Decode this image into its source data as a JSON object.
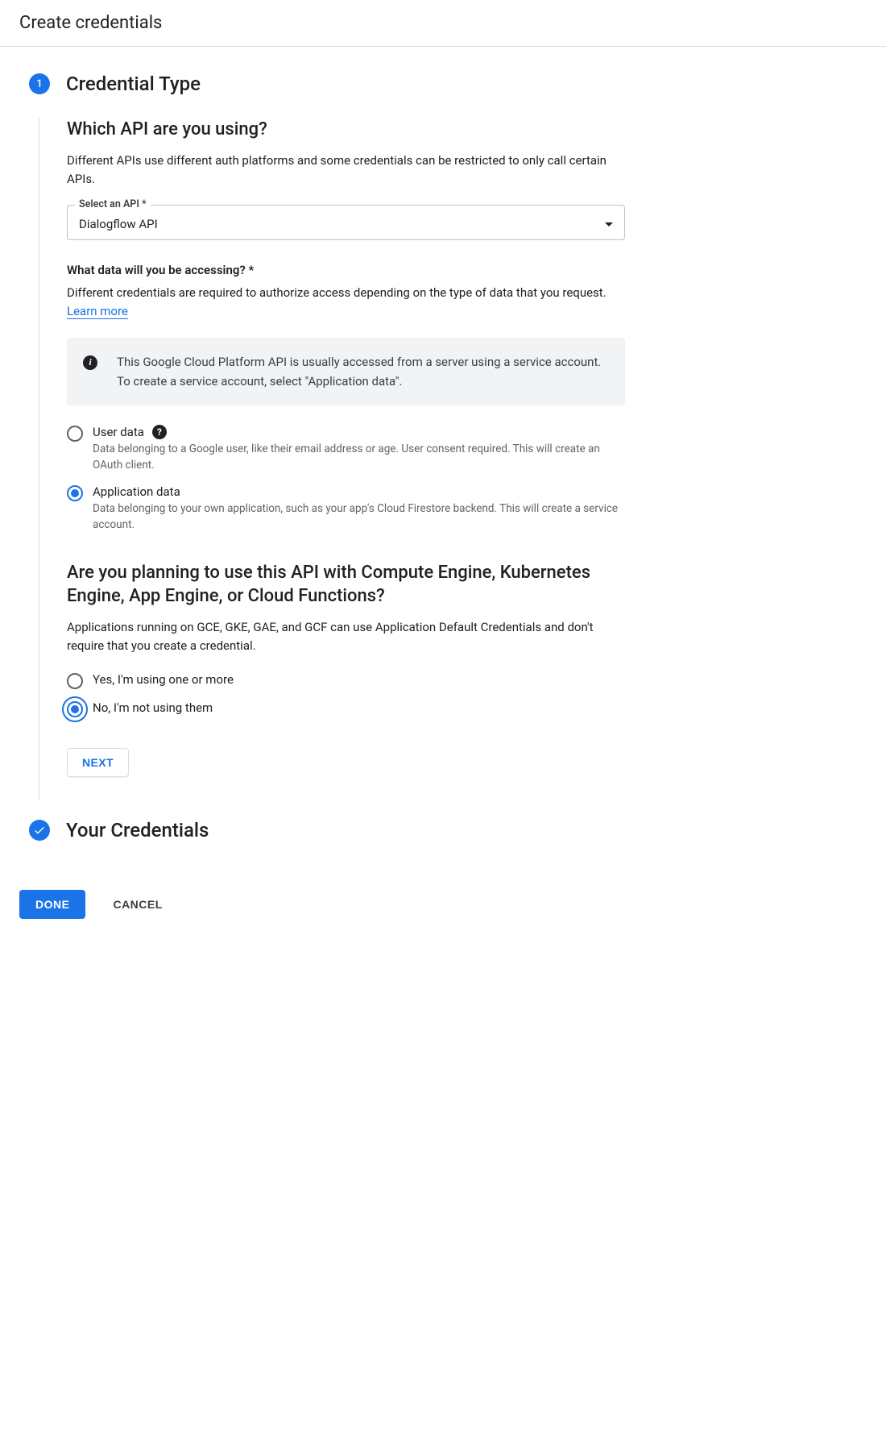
{
  "header": {
    "title": "Create credentials"
  },
  "step1": {
    "number": "1",
    "title": "Credential Type",
    "section1": {
      "heading": "Which API are you using?",
      "desc": "Different APIs use different auth platforms and some credentials can be restricted to only call certain APIs.",
      "select_label": "Select an API *",
      "select_value": "Dialogflow API"
    },
    "section2": {
      "label": "What data will you be accessing? *",
      "desc_prefix": "Different credentials are required to authorize access depending on the type of data that you request. ",
      "learn_more": "Learn more",
      "info": "This Google Cloud Platform API is usually accessed from a server using a service account. To create a service account, select \"Application data\".",
      "radios": [
        {
          "label": "User data",
          "desc": "Data belonging to a Google user, like their email address or age. User consent required. This will create an OAuth client.",
          "checked": false,
          "help": true
        },
        {
          "label": "Application data",
          "desc": "Data belonging to your own application, such as your app's Cloud Firestore backend. This will create a service account.",
          "checked": true,
          "help": false
        }
      ]
    },
    "section3": {
      "heading": "Are you planning to use this API with Compute Engine, Kubernetes Engine, App Engine, or Cloud Functions?",
      "desc": "Applications running on GCE, GKE, GAE, and GCF can use Application Default Credentials and don't require that you create a credential.",
      "radios": [
        {
          "label": "Yes, I'm using one or more",
          "checked": false,
          "focus": false
        },
        {
          "label": "No, I'm not using them",
          "checked": true,
          "focus": true
        }
      ]
    },
    "next_button": "NEXT"
  },
  "step2": {
    "title": "Your Credentials"
  },
  "footer": {
    "done": "DONE",
    "cancel": "CANCEL"
  }
}
